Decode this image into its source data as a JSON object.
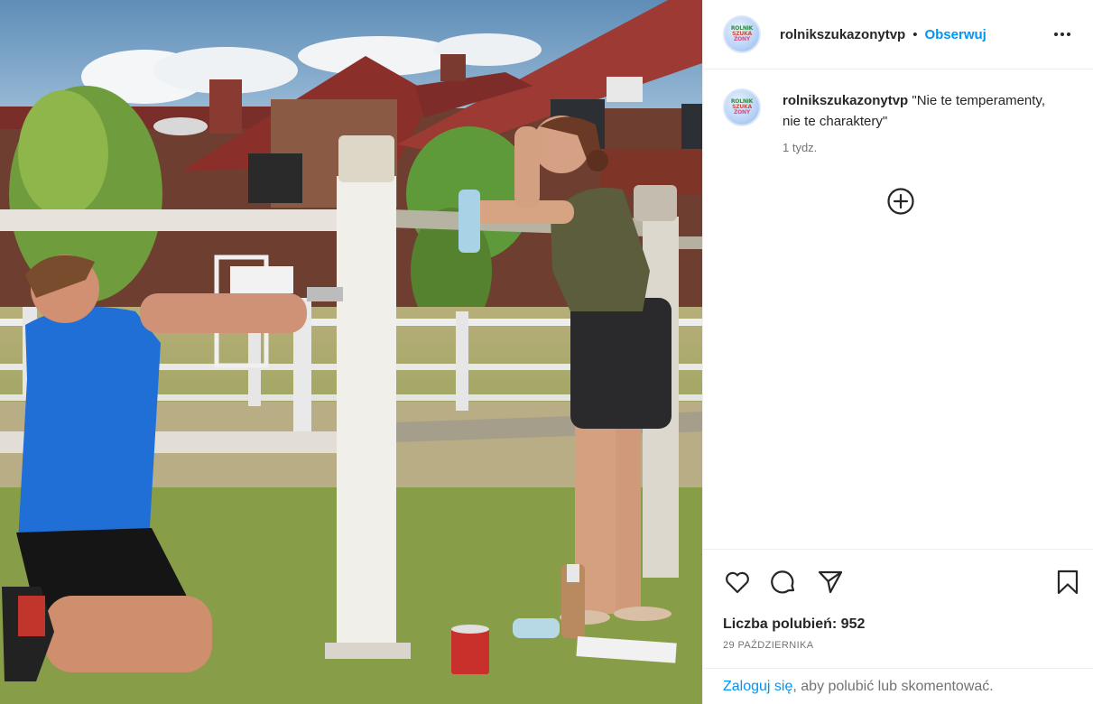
{
  "post": {
    "image_alt": "Photo of a man in a blue shirt painting a white wooden fence post while a woman in a green tank top leans on the fence, in front of a red-roofed house",
    "colors": {
      "accent": "#0095f6",
      "text": "#262626",
      "muted": "#737373"
    }
  },
  "header": {
    "username": "rolnikszukazonytvp",
    "separator": "•",
    "follow_label": "Obserwuj",
    "more_icon": "more-dots-icon"
  },
  "avatar": {
    "line1": "ROLNIK",
    "line2": "SZUKA",
    "line3": "ŻONY"
  },
  "caption": {
    "username": "rolnikszukazonytvp",
    "text": "\"Nie te temperamenty, nie te charaktery\"",
    "time": "1 tydz."
  },
  "add_comment_icon": "plus-circle-icon",
  "actions": {
    "icons": [
      "heart-icon",
      "comment-icon",
      "share-icon",
      "bookmark-icon"
    ],
    "likes": "Liczba polubień: 952",
    "date": "29 PAŹDZIERNIKA"
  },
  "login": {
    "link": "Zaloguj się",
    "rest": ", aby polubić lub skomentować."
  }
}
